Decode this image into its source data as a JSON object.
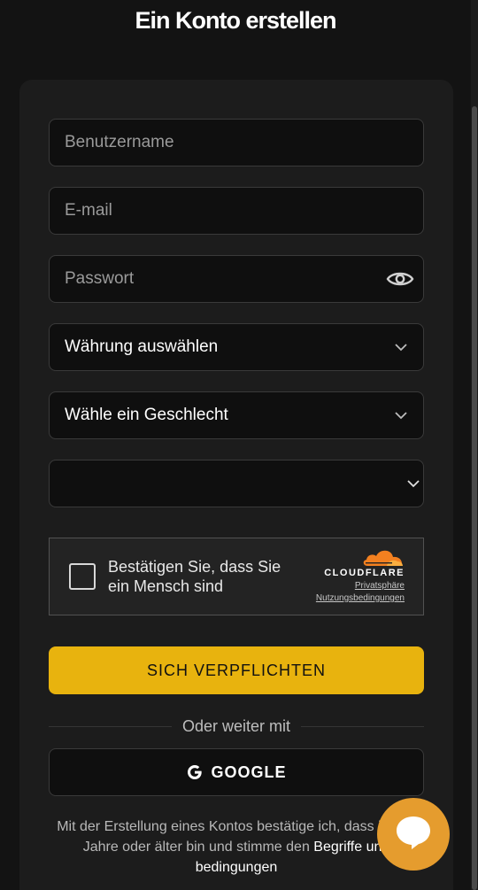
{
  "page": {
    "title": "Ein Konto erstellen"
  },
  "form": {
    "username_placeholder": "Benutzername",
    "email_placeholder": "E-mail",
    "password_placeholder": "Passwort",
    "currency_select": "Währung auswählen",
    "gender_select": "Wähle ein Geschlecht",
    "extra_select": ""
  },
  "captcha": {
    "label": "Bestätigen Sie, dass Sie ein Mensch sind",
    "brand": "CLOUDFLARE",
    "privacy_link": "Privatsphäre",
    "terms_link": "Nutzungsbedingungen"
  },
  "actions": {
    "submit_label": "SICH VERPFLICHTEN",
    "divider_text": "Oder weiter mit",
    "google_label": "GOOGLE"
  },
  "legal": {
    "text": "Mit der Erstellung eines Kontos bestätige ich, dass ich 18 Jahre oder älter bin und stimme den",
    "link": "Begriffe und bedingungen"
  },
  "icons": {
    "eye": "eye-icon",
    "chevron": "chevron-down-icon",
    "google": "google-icon",
    "chat": "chat-icon",
    "cloudflare": "cloudflare-logo"
  },
  "colors": {
    "accent": "#e8b30e",
    "chat": "#e59c2e",
    "cloudflare": "#f38020",
    "background": "#131313",
    "card": "#1c1c1c"
  }
}
